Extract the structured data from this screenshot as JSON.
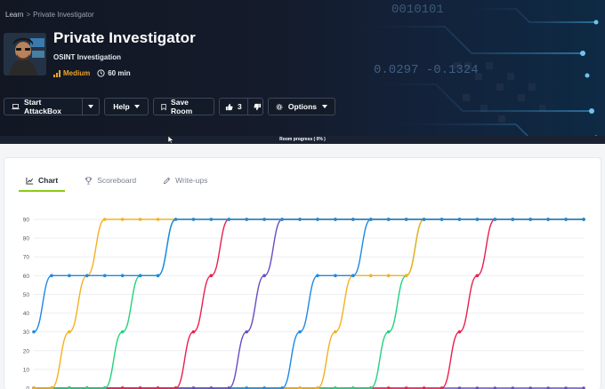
{
  "breadcrumb": {
    "root": "Learn",
    "separator": ">",
    "current": "Private Investigator"
  },
  "room": {
    "title": "Private Investigator",
    "subtitle": "OSINT Investigation",
    "difficulty": "Medium",
    "duration": "60 min",
    "thumbnail_icon": "detective-avatar-icon"
  },
  "toolbar": {
    "attackbox_label": "Start AttackBox",
    "help_label": "Help",
    "save_label": "Save Room",
    "like_count": "3",
    "options_label": "Options"
  },
  "hero_art_text": {
    "binary": "0010101",
    "decimals": "0.0297  -0.1324"
  },
  "progress": {
    "label": "Room progress ( 0% )",
    "value": 0
  },
  "tabs": [
    {
      "label": "Chart",
      "icon": "line-chart-icon",
      "active": true
    },
    {
      "label": "Scoreboard",
      "icon": "trophy-icon",
      "active": false
    },
    {
      "label": "Write-ups",
      "icon": "pen-icon",
      "active": false
    }
  ],
  "colors": {
    "accent": "#88cc14",
    "difficulty": "#f0a52b",
    "series": [
      "#1e88e5",
      "#f5b020",
      "#22d27c",
      "#e8204c",
      "#6a4cc0"
    ]
  },
  "chart_data": {
    "type": "line",
    "title": "",
    "xlabel": "",
    "ylabel": "",
    "ylim": [
      0,
      90
    ],
    "yticks": [
      0,
      10,
      20,
      30,
      40,
      50,
      60,
      70,
      80,
      90
    ],
    "grid": true,
    "x": [
      0,
      1,
      2,
      3,
      4,
      5,
      6,
      7,
      8,
      9,
      10,
      11,
      12,
      13,
      14,
      15,
      16,
      17,
      18,
      19,
      20,
      21,
      22,
      23,
      24,
      25,
      26,
      27,
      28,
      29,
      30,
      31
    ],
    "series": [
      {
        "values": [
          30,
          60,
          60,
          60,
          60,
          60,
          60,
          60,
          90,
          90,
          90,
          90,
          90,
          90,
          90,
          90,
          90,
          90,
          90,
          90,
          90,
          90,
          90,
          90,
          90,
          90,
          90,
          90,
          90,
          90,
          90,
          90
        ]
      },
      {
        "values": [
          0,
          0,
          30,
          60,
          90,
          90,
          90,
          90,
          90,
          90,
          90,
          90,
          90,
          90,
          90,
          90,
          90,
          90,
          90,
          90,
          90,
          90,
          90,
          90,
          90,
          90,
          90,
          90,
          90,
          90,
          90,
          90
        ]
      },
      {
        "values": [
          0,
          0,
          0,
          0,
          0,
          30,
          60,
          60,
          90,
          90,
          90,
          90,
          90,
          90,
          90,
          90,
          90,
          90,
          90,
          90,
          90,
          90,
          90,
          90,
          90,
          90,
          90,
          90,
          90,
          90,
          90,
          90
        ]
      },
      {
        "values": [
          0,
          0,
          0,
          0,
          0,
          0,
          0,
          0,
          0,
          30,
          60,
          90,
          90,
          90,
          90,
          90,
          90,
          90,
          90,
          90,
          90,
          90,
          90,
          90,
          90,
          90,
          90,
          90,
          90,
          90,
          90,
          90
        ]
      },
      {
        "values": [
          0,
          0,
          0,
          0,
          0,
          0,
          0,
          0,
          0,
          0,
          0,
          0,
          30,
          60,
          90,
          90,
          90,
          90,
          90,
          90,
          90,
          90,
          90,
          90,
          90,
          90,
          90,
          90,
          90,
          90,
          90,
          90
        ]
      },
      {
        "values": [
          0,
          0,
          0,
          0,
          0,
          0,
          0,
          0,
          0,
          0,
          0,
          0,
          0,
          0,
          0,
          30,
          60,
          60,
          60,
          90,
          90,
          90,
          90,
          90,
          90,
          90,
          90,
          90,
          90,
          90,
          90,
          90
        ]
      },
      {
        "values": [
          0,
          0,
          0,
          0,
          0,
          0,
          0,
          0,
          0,
          0,
          0,
          0,
          0,
          0,
          0,
          0,
          0,
          30,
          60,
          60,
          60,
          60,
          90,
          90,
          90,
          90,
          90,
          90,
          90,
          90,
          90,
          90
        ]
      },
      {
        "values": [
          0,
          0,
          0,
          0,
          0,
          0,
          0,
          0,
          0,
          0,
          0,
          0,
          0,
          0,
          0,
          0,
          0,
          0,
          0,
          0,
          30,
          60,
          90,
          90,
          90,
          90,
          90,
          90,
          90,
          90,
          90,
          90
        ]
      },
      {
        "values": [
          0,
          0,
          0,
          0,
          0,
          0,
          0,
          0,
          0,
          0,
          0,
          0,
          0,
          0,
          0,
          0,
          0,
          0,
          0,
          0,
          0,
          0,
          0,
          0,
          30,
          60,
          90,
          90,
          90,
          90,
          90,
          90
        ]
      },
      {
        "values": [
          0,
          0,
          0,
          0,
          0,
          0,
          0,
          0,
          0,
          0,
          0,
          0,
          0,
          0,
          0,
          0,
          0,
          0,
          0,
          0,
          0,
          0,
          0,
          0,
          0,
          0,
          0,
          0,
          0,
          0,
          0,
          0
        ]
      }
    ]
  }
}
